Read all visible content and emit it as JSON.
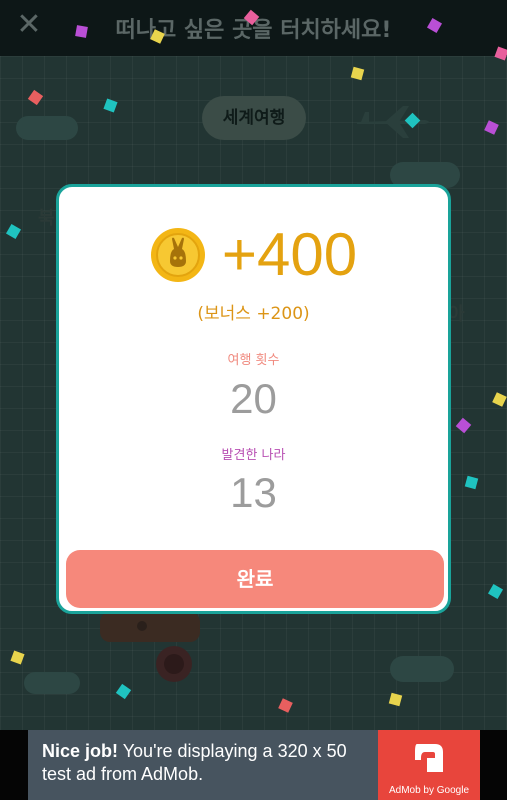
{
  "header": {
    "title": "떠나고 싶은 곳을 터치하세요!",
    "close_icon": "close-icon"
  },
  "background": {
    "world_label": "세계여행",
    "cut_label_left": "북",
    "cut_label_right": "아"
  },
  "dialog": {
    "coin_icon": "rabbit-coin-icon",
    "reward_text": "+400",
    "bonus_text": "(보너스 +200)",
    "trips_label": "여행 횟수",
    "trips_value": "20",
    "countries_label": "발견한 나라",
    "countries_value": "13",
    "done_label": "완료",
    "colors": {
      "accent_border": "#1aa39a",
      "reward": "#e4a210",
      "trips_label": "#f08a7f",
      "countries_label": "#b84fb3",
      "button": "#f6887b"
    }
  },
  "ad": {
    "bold_text": "Nice job!",
    "body_text": " You're displaying a 320 x 50 test ad from AdMob.",
    "logo_caption": "AdMob by Google"
  }
}
